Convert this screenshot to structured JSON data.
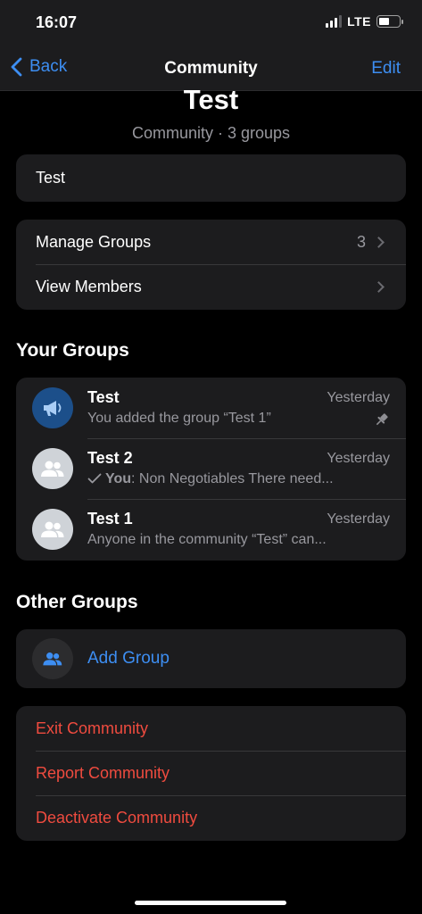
{
  "status_bar": {
    "time": "16:07",
    "network": "LTE",
    "signal_bars": 4,
    "signal_active": 3,
    "battery_level": 0.55
  },
  "nav": {
    "back_label": "Back",
    "title": "Community",
    "edit_label": "Edit",
    "accent_color": "#3d8ef2"
  },
  "header": {
    "title": "Test",
    "subtitle": "Community · 3 groups"
  },
  "description": "Test",
  "menu": {
    "manage_groups": {
      "label": "Manage Groups",
      "count": "3"
    },
    "view_members": {
      "label": "View Members"
    }
  },
  "your_groups": {
    "heading": "Your Groups",
    "items": [
      {
        "name": "Test",
        "time": "Yesterday",
        "message": "You added the group “Test 1”",
        "icon": "megaphone-icon",
        "pinned": true
      },
      {
        "name": "Test 2",
        "time": "Yesterday",
        "message_sender": "You",
        "message": ": Non Negotiables There need...",
        "icon": "group-people-icon",
        "status_icon": "checkmark-icon"
      },
      {
        "name": "Test 1",
        "time": "Yesterday",
        "message": "Anyone in the community “Test” can...",
        "icon": "group-people-icon"
      }
    ]
  },
  "other_groups": {
    "heading": "Other Groups",
    "add_label": "Add Group"
  },
  "actions": {
    "exit": "Exit Community",
    "report": "Report Community",
    "deactivate": "Deactivate Community",
    "danger_color": "#ef4b3f"
  }
}
